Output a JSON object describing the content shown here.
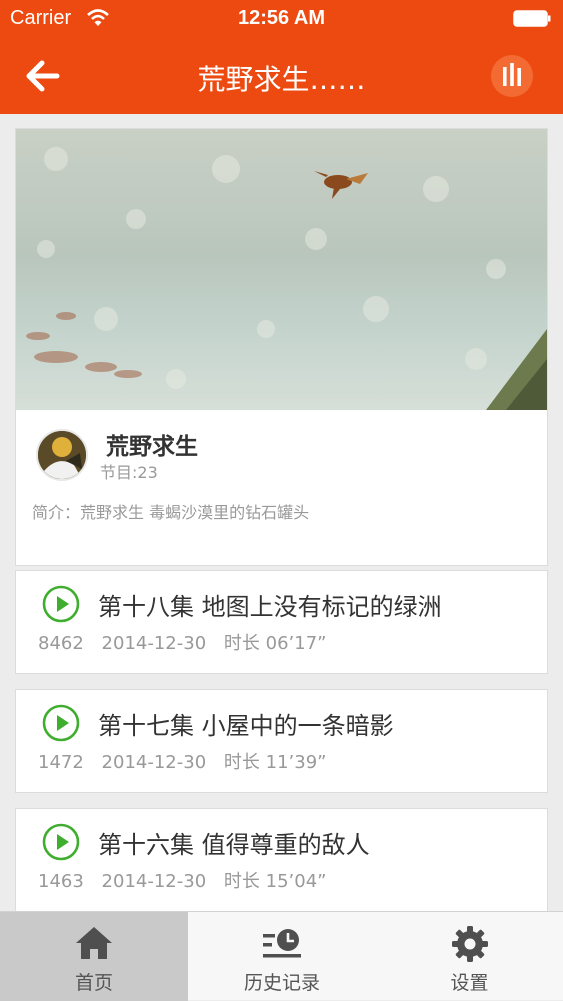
{
  "status_bar": {
    "carrier": "Carrier",
    "time": "12:56 AM"
  },
  "nav": {
    "title": "荒野求生……"
  },
  "album": {
    "title": "荒野求生",
    "count": "节目:23",
    "intro": "简介：荒野求生 毒蝎沙漠里的钻石罐头"
  },
  "episodes": [
    {
      "title": "第十八集 地图上没有标记的绿洲",
      "plays": "8462",
      "date": "2014-12-30",
      "duration": "时长 06’17”"
    },
    {
      "title": "第十七集 小屋中的一条暗影",
      "plays": "1472",
      "date": "2014-12-30",
      "duration": "时长 11’39”"
    },
    {
      "title": "第十六集 值得尊重的敌人",
      "plays": "1463",
      "date": "2014-12-30",
      "duration": "时长 15’04”"
    }
  ],
  "tabs": [
    {
      "label": "首页",
      "icon": "home-icon",
      "active": true
    },
    {
      "label": "历史记录",
      "icon": "history-icon",
      "active": false
    },
    {
      "label": "设置",
      "icon": "gear-icon",
      "active": false
    }
  ],
  "colors": {
    "accent": "#ec4a10",
    "play_green": "#3fae2e",
    "tab_active_bg": "#c9c9c9"
  }
}
